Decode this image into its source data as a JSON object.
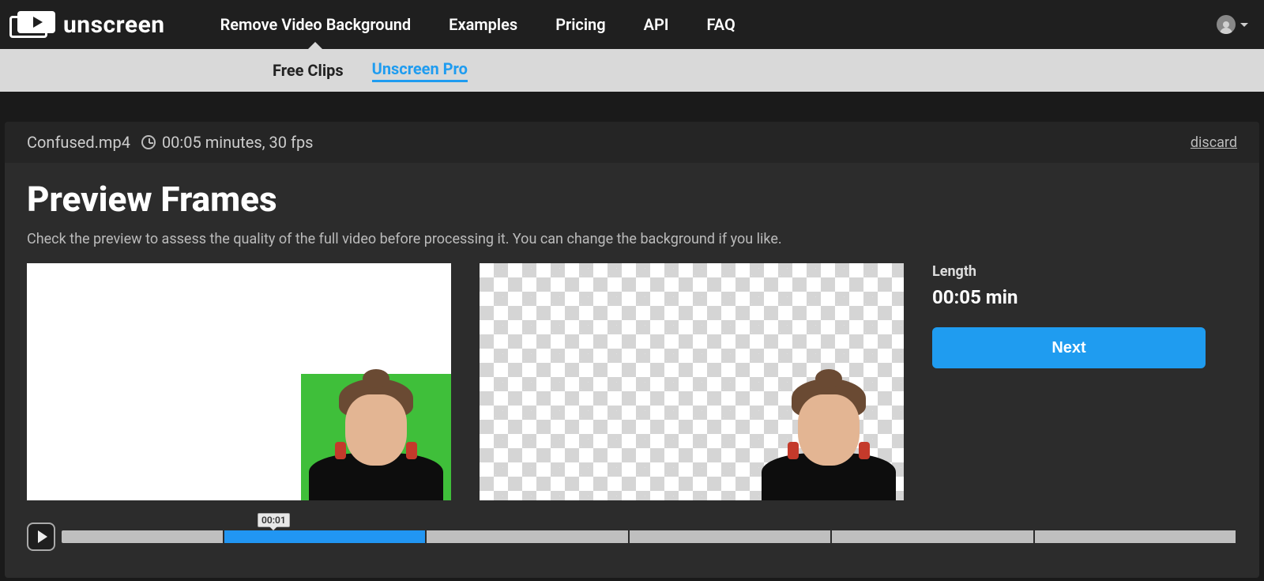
{
  "brand": "unscreen",
  "nav": {
    "items": [
      {
        "label": "Remove Video Background",
        "active": true
      },
      {
        "label": "Examples"
      },
      {
        "label": "Pricing"
      },
      {
        "label": "API"
      },
      {
        "label": "FAQ"
      }
    ]
  },
  "subnav": {
    "items": [
      {
        "label": "Free Clips"
      },
      {
        "label": "Unscreen Pro",
        "active": true
      }
    ]
  },
  "file": {
    "name": "Confused.mp4",
    "meta": "00:05 minutes, 30 fps"
  },
  "discard_label": "discard",
  "title": "Preview Frames",
  "subtitle": "Check the preview to assess the quality of the full video before processing it. You can change the background if you like.",
  "sidebar": {
    "length_label": "Length",
    "length_value": "00:05 min",
    "next_label": "Next"
  },
  "timeline": {
    "marker_label": "00:01"
  }
}
